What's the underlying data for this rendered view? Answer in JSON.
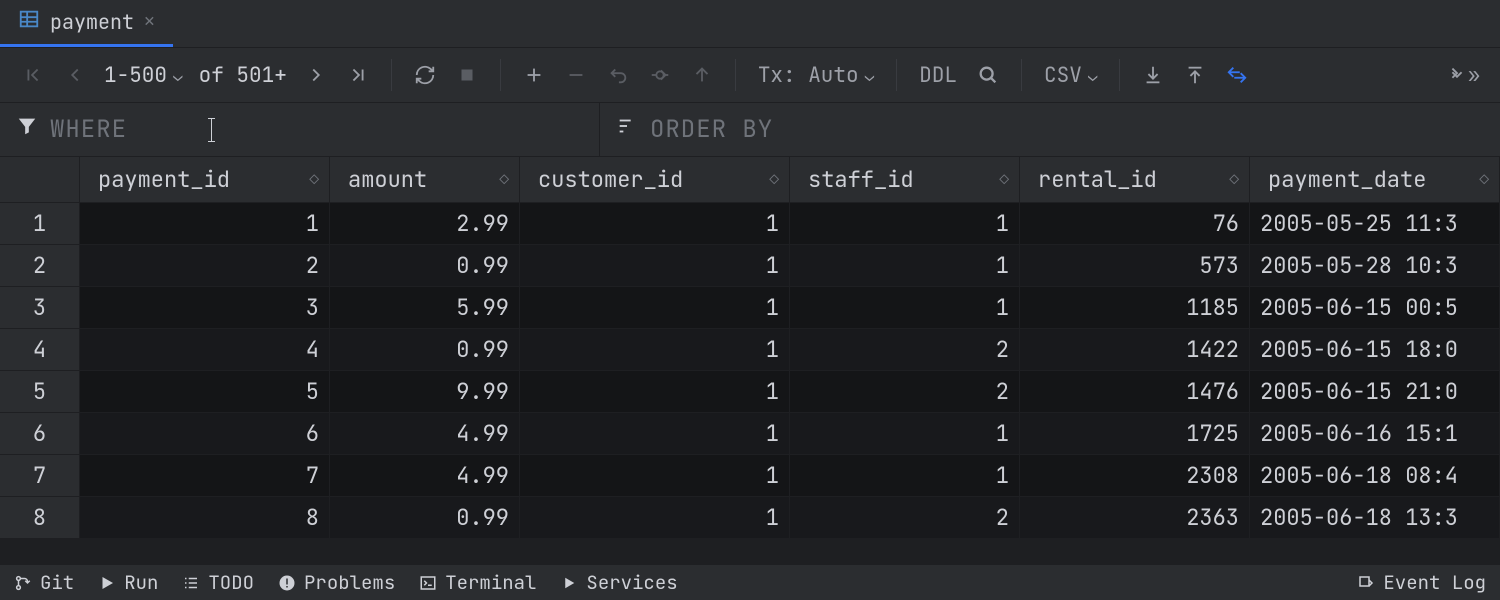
{
  "tab": {
    "title": "payment"
  },
  "toolbar": {
    "range": "1-500",
    "of_label": "of 501+",
    "tx_label": "Tx: Auto",
    "ddl_label": "DDL",
    "csv_label": "CSV"
  },
  "filter": {
    "where_label": "WHERE",
    "order_label": "ORDER BY"
  },
  "columns": [
    {
      "name": "payment_id",
      "pk": true
    },
    {
      "name": "amount",
      "pk": false
    },
    {
      "name": "customer_id",
      "pk": true
    },
    {
      "name": "staff_id",
      "pk": true
    },
    {
      "name": "rental_id",
      "pk": true
    },
    {
      "name": "payment_date",
      "pk": false
    }
  ],
  "rows": [
    {
      "n": 1,
      "payment_id": 1,
      "amount": "2.99",
      "customer_id": 1,
      "staff_id": 1,
      "rental_id": 76,
      "payment_date": "2005-05-25 11:3"
    },
    {
      "n": 2,
      "payment_id": 2,
      "amount": "0.99",
      "customer_id": 1,
      "staff_id": 1,
      "rental_id": 573,
      "payment_date": "2005-05-28 10:3"
    },
    {
      "n": 3,
      "payment_id": 3,
      "amount": "5.99",
      "customer_id": 1,
      "staff_id": 1,
      "rental_id": 1185,
      "payment_date": "2005-06-15 00:5"
    },
    {
      "n": 4,
      "payment_id": 4,
      "amount": "0.99",
      "customer_id": 1,
      "staff_id": 2,
      "rental_id": 1422,
      "payment_date": "2005-06-15 18:0"
    },
    {
      "n": 5,
      "payment_id": 5,
      "amount": "9.99",
      "customer_id": 1,
      "staff_id": 2,
      "rental_id": 1476,
      "payment_date": "2005-06-15 21:0"
    },
    {
      "n": 6,
      "payment_id": 6,
      "amount": "4.99",
      "customer_id": 1,
      "staff_id": 1,
      "rental_id": 1725,
      "payment_date": "2005-06-16 15:1"
    },
    {
      "n": 7,
      "payment_id": 7,
      "amount": "4.99",
      "customer_id": 1,
      "staff_id": 1,
      "rental_id": 2308,
      "payment_date": "2005-06-18 08:4"
    },
    {
      "n": 8,
      "payment_id": 8,
      "amount": "0.99",
      "customer_id": 1,
      "staff_id": 2,
      "rental_id": 2363,
      "payment_date": "2005-06-18 13:3"
    }
  ],
  "status": {
    "git": "Git",
    "run": "Run",
    "todo": "TODO",
    "problems": "Problems",
    "terminal": "Terminal",
    "services": "Services",
    "event_log": "Event Log"
  }
}
